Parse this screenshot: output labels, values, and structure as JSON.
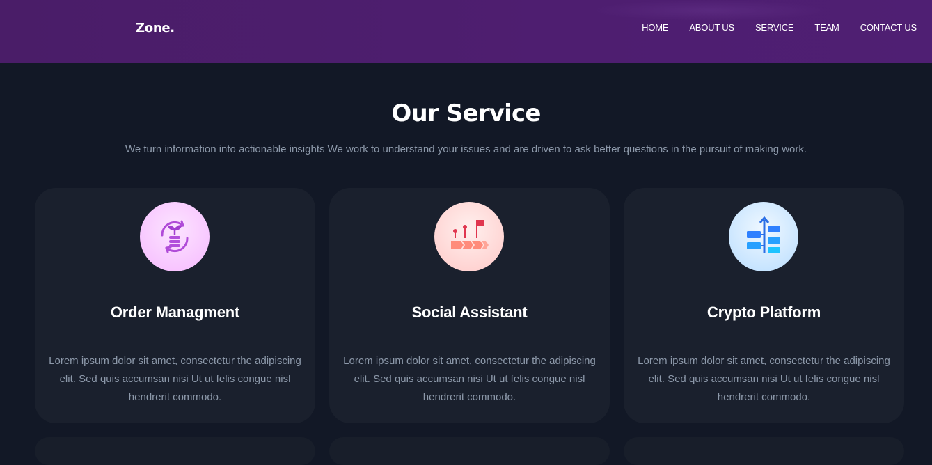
{
  "header": {
    "logo": "Zone.",
    "nav": [
      {
        "label": "HOME"
      },
      {
        "label": "ABOUT US"
      },
      {
        "label": "SERVICE"
      },
      {
        "label": "TEAM"
      },
      {
        "label": "CONTACT US"
      }
    ]
  },
  "section": {
    "title": "Our Service",
    "subtitle": "We turn information into actionable insights We work to understand your issues and are driven to ask better questions in the pursuit of making work."
  },
  "cards": [
    {
      "icon": "growth-cycle-icon",
      "title": "Order Managment",
      "text": "Lorem ipsum dolor sit amet, consectetur the adipiscing elit. Sed quis accumsan nisi Ut ut felis congue nisl hendrerit commodo."
    },
    {
      "icon": "roadmap-flag-icon",
      "title": "Social Assistant",
      "text": "Lorem ipsum dolor sit amet, consectetur the adipiscing elit. Sed quis accumsan nisi Ut ut felis congue nisl hendrerit commodo."
    },
    {
      "icon": "timeline-icon",
      "title": "Crypto Platform",
      "text": "Lorem ipsum dolor sit amet, consectetur the adipiscing elit. Sed quis accumsan nisi Ut ut felis congue nisl hendrerit commodo."
    }
  ],
  "colors": {
    "header_bg": "#4e1e70",
    "page_bg": "#121826",
    "card_bg": "#1a202d",
    "muted_text": "#8d99aa"
  }
}
